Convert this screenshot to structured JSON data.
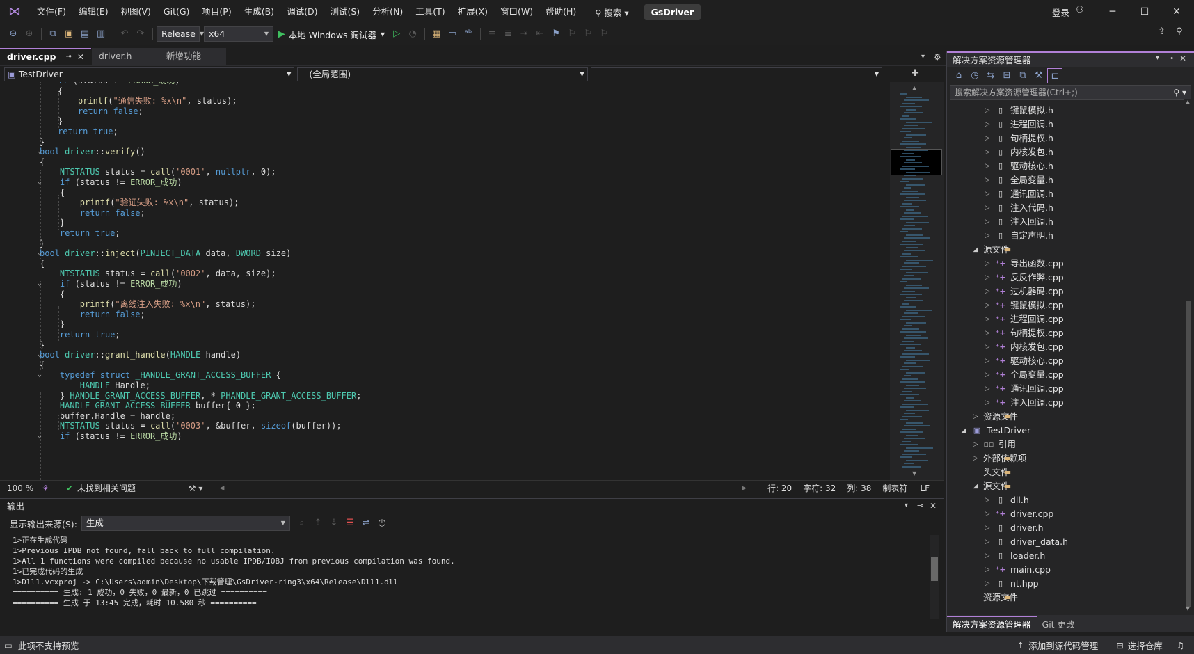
{
  "titlebar": {
    "menu": [
      "文件(F)",
      "编辑(E)",
      "视图(V)",
      "Git(G)",
      "项目(P)",
      "生成(B)",
      "调试(D)",
      "测试(S)",
      "分析(N)",
      "工具(T)",
      "扩展(X)",
      "窗口(W)",
      "帮助(H)"
    ],
    "search": "搜索",
    "app_name": "GsDriver",
    "signin": "登录"
  },
  "toolbar": {
    "config": "Release",
    "platform": "x64",
    "run_label": "本地 Windows 调试器"
  },
  "tabs": [
    {
      "label": "driver.cpp",
      "active": true
    },
    {
      "label": "driver.h",
      "active": false
    },
    {
      "label": "新增功能",
      "active": false
    }
  ],
  "navbar": {
    "project": "TestDriver",
    "scope": "(全局范围)",
    "member": ""
  },
  "editor": {
    "lines": [
      "if (status != ERROR_成功)",
      "{",
      "    printf(\"通信失败: %x\\n\", status);",
      "    return false;",
      "}",
      "return true;",
      "}",
      "bool driver::verify()",
      "{",
      "    NTSTATUS status = call('0001', nullptr, 0);",
      "    if (status != ERROR_成功)",
      "    {",
      "        printf(\"验证失败: %x\\n\", status);",
      "        return false;",
      "    }",
      "    return true;",
      "}",
      "bool driver::inject(PINJECT_DATA data, DWORD size)",
      "{",
      "    NTSTATUS status = call('0002', data, size);",
      "    if (status != ERROR_成功)",
      "    {",
      "        printf(\"离线注入失败: %x\\n\", status);",
      "        return false;",
      "    }",
      "    return true;",
      "}",
      "bool driver::grant_handle(HANDLE handle)",
      "{",
      "    typedef struct _HANDLE_GRANT_ACCESS_BUFFER {",
      "        HANDLE Handle;",
      "    } HANDLE_GRANT_ACCESS_BUFFER, * PHANDLE_GRANT_ACCESS_BUFFER;",
      "    HANDLE_GRANT_ACCESS_BUFFER buffer{ 0 };",
      "    buffer.Handle = handle;",
      "    NTSTATUS status = call('0003', &buffer, sizeof(buffer));",
      "    if (status != ERROR_成功)"
    ]
  },
  "edstatus": {
    "zoom": "100 %",
    "issues": "未找到相关问题",
    "line": "行: 20",
    "char": "字符: 32",
    "col": "列: 38",
    "tabs": "制表符",
    "eol": "LF"
  },
  "output": {
    "title": "输出",
    "source_label": "显示输出来源(S):",
    "source_value": "生成",
    "log": [
      "1>正在生成代码",
      "1>Previous IPDB not found, fall back to full compilation.",
      "1>All 1 functions were compiled because no usable IPDB/IOBJ from previous compilation was found.",
      "1>已完成代码的生成",
      "1>Dll1.vcxproj -> C:\\Users\\admin\\Desktop\\下载管理\\GsDriver-ring3\\x64\\Release\\Dll1.dll",
      "========== 生成: 1 成功，0 失败，0 最新，0 已跳过 ==========",
      "========== 生成 于 13:45 完成，耗时 10.580 秒 =========="
    ]
  },
  "solution_explorer": {
    "title": "解决方案资源管理器",
    "search_placeholder": "搜索解决方案资源管理器(Ctrl+;)",
    "items": [
      {
        "depth": 3,
        "label": "键鼠模拟.h",
        "icon": "h",
        "exp": "▷"
      },
      {
        "depth": 3,
        "label": "进程回调.h",
        "icon": "h",
        "exp": "▷"
      },
      {
        "depth": 3,
        "label": "句柄提权.h",
        "icon": "h",
        "exp": "▷"
      },
      {
        "depth": 3,
        "label": "内核发包.h",
        "icon": "h",
        "exp": "▷"
      },
      {
        "depth": 3,
        "label": "驱动核心.h",
        "icon": "h",
        "exp": "▷"
      },
      {
        "depth": 3,
        "label": "全局变量.h",
        "icon": "h",
        "exp": "▷"
      },
      {
        "depth": 3,
        "label": "通讯回调.h",
        "icon": "h",
        "exp": "▷"
      },
      {
        "depth": 3,
        "label": "注入代码.h",
        "icon": "h",
        "exp": "▷"
      },
      {
        "depth": 3,
        "label": "注入回调.h",
        "icon": "h",
        "exp": "▷"
      },
      {
        "depth": 3,
        "label": "自定声明.h",
        "icon": "h",
        "exp": "▷"
      },
      {
        "depth": 2,
        "label": "源文件",
        "icon": "fold",
        "exp": "◢"
      },
      {
        "depth": 3,
        "label": "导出函数.cpp",
        "icon": "cpp",
        "exp": "▷"
      },
      {
        "depth": 3,
        "label": "反反作弊.cpp",
        "icon": "cpp",
        "exp": "▷"
      },
      {
        "depth": 3,
        "label": "过机器码.cpp",
        "icon": "cpp",
        "exp": "▷"
      },
      {
        "depth": 3,
        "label": "键鼠模拟.cpp",
        "icon": "cpp",
        "exp": "▷"
      },
      {
        "depth": 3,
        "label": "进程回调.cpp",
        "icon": "cpp",
        "exp": "▷"
      },
      {
        "depth": 3,
        "label": "句柄提权.cpp",
        "icon": "cpp",
        "exp": "▷"
      },
      {
        "depth": 3,
        "label": "内核发包.cpp",
        "icon": "cpp",
        "exp": "▷"
      },
      {
        "depth": 3,
        "label": "驱动核心.cpp",
        "icon": "cpp",
        "exp": "▷"
      },
      {
        "depth": 3,
        "label": "全局变量.cpp",
        "icon": "cpp",
        "exp": "▷"
      },
      {
        "depth": 3,
        "label": "通讯回调.cpp",
        "icon": "cpp",
        "exp": "▷"
      },
      {
        "depth": 3,
        "label": "注入回调.cpp",
        "icon": "cpp",
        "exp": "▷"
      },
      {
        "depth": 2,
        "label": "资源文件",
        "icon": "fold",
        "exp": "▷"
      },
      {
        "depth": 1,
        "label": "TestDriver",
        "icon": "proj",
        "exp": "◢"
      },
      {
        "depth": 2,
        "label": "引用",
        "icon": "ref",
        "exp": "▷"
      },
      {
        "depth": 2,
        "label": "外部依赖项",
        "icon": "fold",
        "exp": "▷"
      },
      {
        "depth": 2,
        "label": "头文件",
        "icon": "fold",
        "exp": ""
      },
      {
        "depth": 2,
        "label": "源文件",
        "icon": "fold",
        "exp": "◢"
      },
      {
        "depth": 3,
        "label": "dll.h",
        "icon": "h",
        "exp": "▷"
      },
      {
        "depth": 3,
        "label": "driver.cpp",
        "icon": "cpp",
        "exp": "▷"
      },
      {
        "depth": 3,
        "label": "driver.h",
        "icon": "h",
        "exp": "▷"
      },
      {
        "depth": 3,
        "label": "driver_data.h",
        "icon": "h",
        "exp": "▷"
      },
      {
        "depth": 3,
        "label": "loader.h",
        "icon": "h",
        "exp": "▷"
      },
      {
        "depth": 3,
        "label": "main.cpp",
        "icon": "cpp",
        "exp": "▷"
      },
      {
        "depth": 3,
        "label": "nt.hpp",
        "icon": "h",
        "exp": "▷"
      },
      {
        "depth": 2,
        "label": "资源文件",
        "icon": "fold",
        "exp": ""
      }
    ],
    "bottom_tabs": [
      "解决方案资源管理器",
      "Git 更改"
    ]
  },
  "statusbar": {
    "left": "此项不支持预览",
    "source_control": "添加到源代码管理",
    "repo": "选择仓库"
  }
}
